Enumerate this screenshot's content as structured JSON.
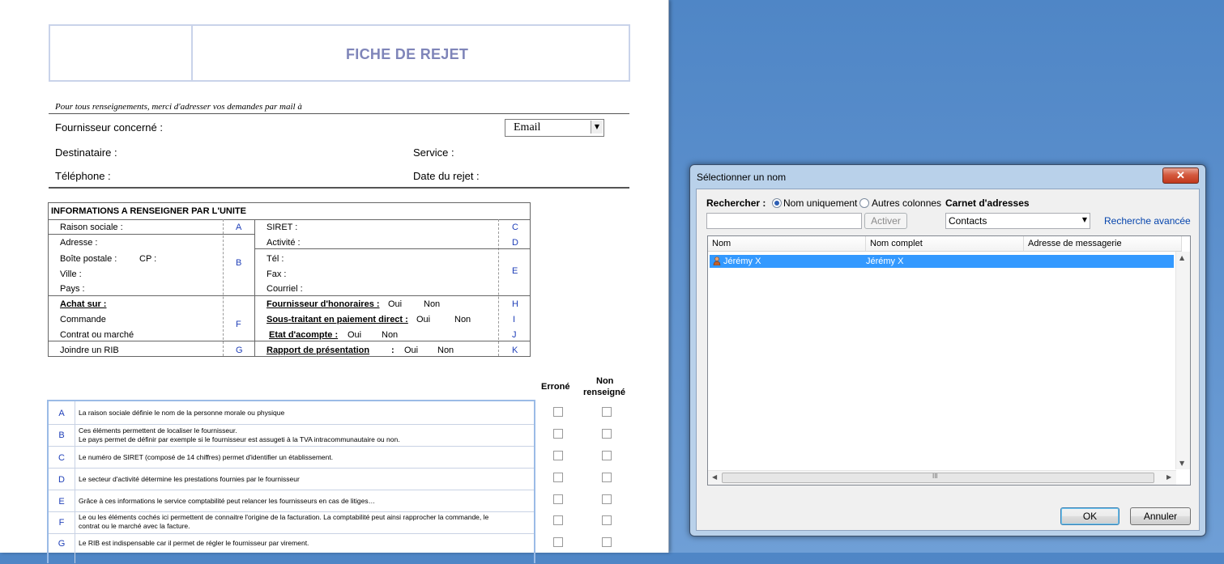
{
  "document": {
    "title": "FICHE DE REJET",
    "contact_note": "Pour tous renseignements, merci d'adresser vos demandes par mail à",
    "fields": {
      "fournisseur": "Fournisseur concerné :",
      "destinataire": "Destinataire :",
      "telephone": "Téléphone :",
      "service": "Service :",
      "date_rejet": "Date du rejet :"
    },
    "contact_select": {
      "value": "Email"
    },
    "info_section": {
      "heading": "INFORMATIONS A RENSEIGNER PAR L'UNITE",
      "left": {
        "raison_sociale": "Raison sociale :",
        "adresse": "Adresse :",
        "boite_postale": "Boîte postale :",
        "cp": "CP :",
        "ville": "Ville :",
        "pays": "Pays :",
        "achat_sur": "Achat sur :",
        "commande": "Commande",
        "contrat": "Contrat ou marché",
        "rib": "Joindre un RIB"
      },
      "right": {
        "siret": "SIRET :",
        "activite": "Activité :",
        "tel": "Tél :",
        "fax": "Fax :",
        "courriel": "Courriel :",
        "fournisseur_honoraires": "Fournisseur d'honoraires :",
        "sous_traitant": "Sous-traitant en paiement direct :",
        "etat_acompte": "Etat d'acompte :",
        "rapport": "Rapport de présentation",
        "rapport_colon": ":",
        "oui": "Oui",
        "non": "Non"
      },
      "letters": [
        "A",
        "B",
        "F",
        "G",
        "C",
        "D",
        "E",
        "H",
        "I",
        "J",
        "K"
      ]
    },
    "checklist": {
      "col_errone": "Erroné",
      "col_non_renseigne_1": "Non",
      "col_non_renseigne_2": "renseigné",
      "rows": [
        {
          "letter": "A",
          "text": "La raison sociale définie le nom de la personne morale ou physique",
          "text2": ""
        },
        {
          "letter": "B",
          "text": "Ces éléments permettent de localiser le fournisseur.",
          "text2": "Le pays permet de définir par exemple si le fournisseur est assugeti à la TVA intracommunautaire ou non."
        },
        {
          "letter": "C",
          "text": "Le numéro de SIRET (composé de 14 chiffres) permet d'identifier un établissement.",
          "text2": ""
        },
        {
          "letter": "D",
          "text": "Le secteur d'activité détermine les prestations fournies par le fournisseur",
          "text2": ""
        },
        {
          "letter": "E",
          "text": "Grâce à ces informations le service comptabilité peut relancer les fournisseurs en cas de litiges…",
          "text2": ""
        },
        {
          "letter": "F",
          "text": "Le ou les éléments cochés ici permettent de connaitre l'origine de la facturation. La comptabilité peut ainsi rapprocher la commande, le",
          "text2": "contrat ou le marché avec la facture."
        },
        {
          "letter": "G",
          "text": "Le RIB est indispensable car il permet de régler le fournisseur par virement.",
          "text2": ""
        }
      ]
    }
  },
  "dialog": {
    "title": "Sélectionner un nom",
    "close_glyph": "✕",
    "search_label": "Rechercher :",
    "radio_name_only": "Nom uniquement",
    "radio_other_columns": "Autres colonnes",
    "address_book_label": "Carnet d'adresses",
    "activate_button": "Activer",
    "address_book_value": "Contacts",
    "advanced_search": "Recherche avancée",
    "columns": [
      "Nom",
      "Nom complet",
      "Adresse de messagerie"
    ],
    "rows": [
      {
        "nom": "Jérémy X",
        "nom_complet": "Jérémy X",
        "email": ""
      }
    ],
    "scroll_grip": "III",
    "ok_button": "OK",
    "cancel_button": "Annuler"
  }
}
